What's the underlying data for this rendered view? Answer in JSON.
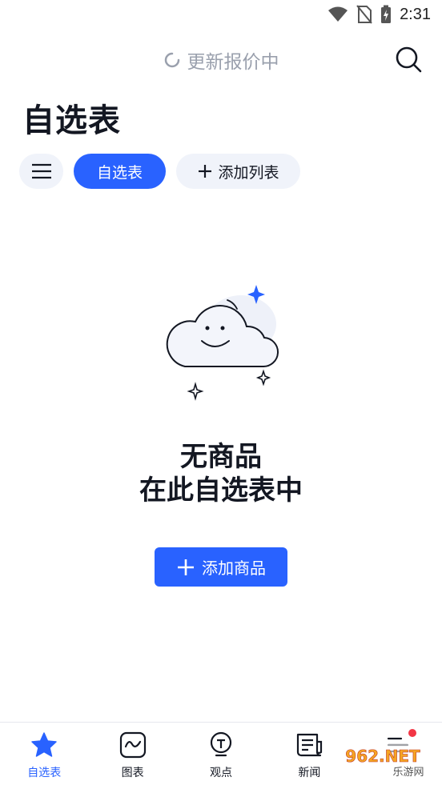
{
  "status_bar": {
    "time": "2:31"
  },
  "top_bar": {
    "status_text": "更新报价中"
  },
  "page": {
    "title": "自选表"
  },
  "chips": {
    "active_label": "自选表",
    "add_label": "添加列表"
  },
  "empty_state": {
    "line1": "无商品",
    "line2": "在此自选表中",
    "button_label": "添加商品"
  },
  "bottom_nav": {
    "items": [
      {
        "label": "自选表",
        "icon": "star-icon",
        "active": true
      },
      {
        "label": "图表",
        "icon": "chart-icon",
        "active": false
      },
      {
        "label": "观点",
        "icon": "lightbulb-icon",
        "active": false
      },
      {
        "label": "新闻",
        "icon": "news-icon",
        "active": false
      },
      {
        "label": "",
        "icon": "menu-icon",
        "active": false
      }
    ]
  },
  "watermark": {
    "text": "962.NET",
    "subtext": "乐游网"
  },
  "colors": {
    "accent": "#2962ff",
    "chip_bg": "#f0f3fa",
    "badge": "#f23645",
    "muted": "#9aa0ad"
  }
}
